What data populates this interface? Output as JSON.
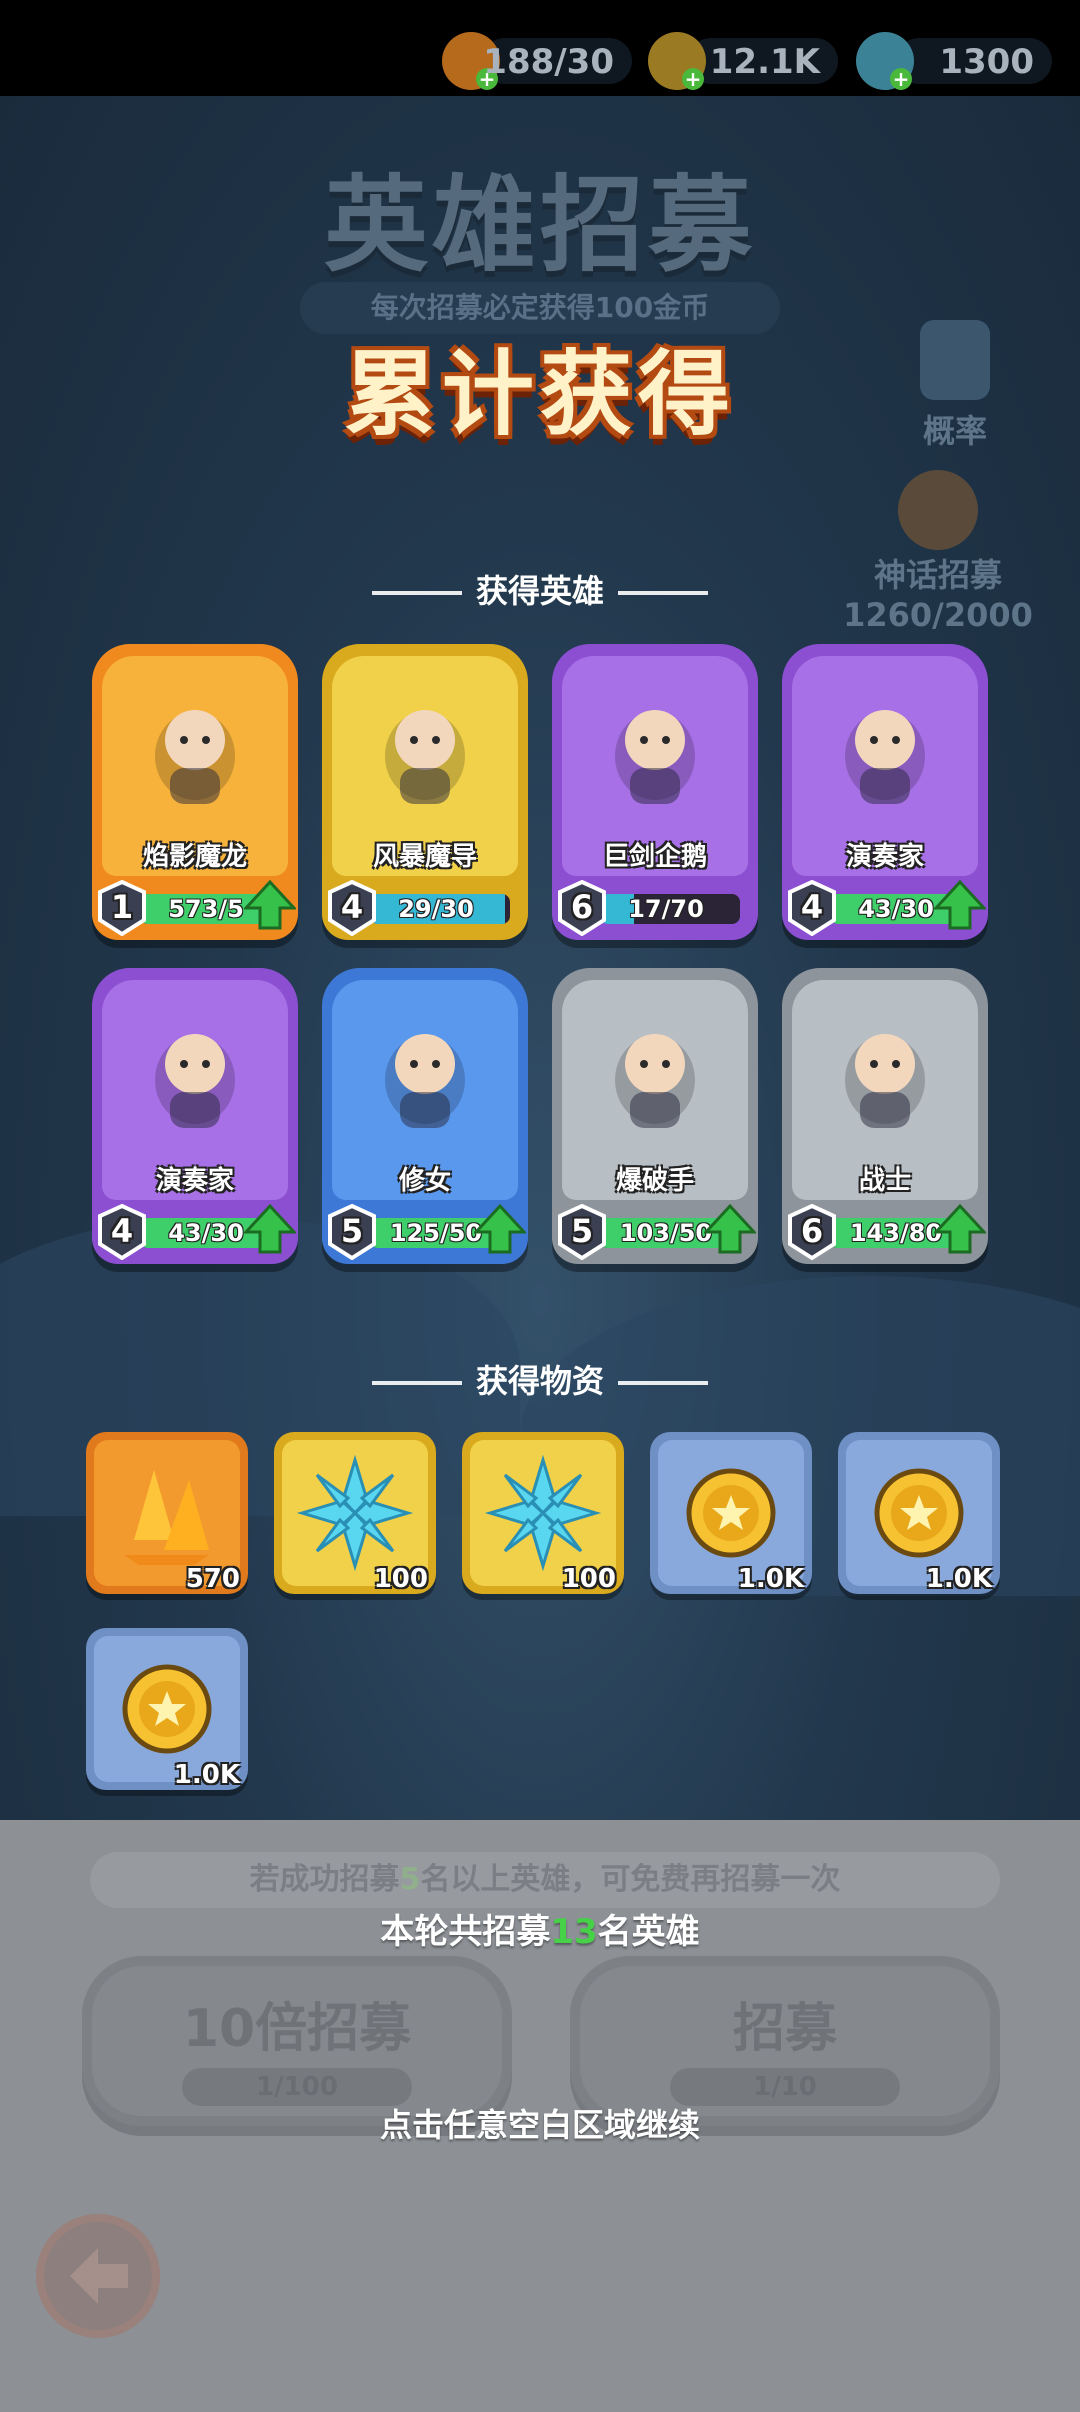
{
  "resources": [
    {
      "icon": "flame-stamina-icon",
      "value": "188/30",
      "color": "#e58a1f"
    },
    {
      "icon": "gold-coin-icon",
      "value": "12.1K",
      "color": "#e3b12a"
    },
    {
      "icon": "ice-crystal-icon",
      "value": "1300",
      "color": "#5fd0e6"
    }
  ],
  "background": {
    "title": "英雄招募",
    "subtitle": "每次招募必定获得100金币",
    "probability_label": "概率",
    "myth_label": "神话招募",
    "myth_progress": "1260/2000"
  },
  "popup": {
    "title": "累计获得",
    "heroes_section": "获得英雄",
    "items_section": "获得物资",
    "heroes": [
      {
        "name": "焰影魔龙",
        "level": "1",
        "progress": "573/5",
        "rarity": "orange",
        "can_upgrade": true
      },
      {
        "name": "风暴魔导",
        "level": "4",
        "progress": "29/30",
        "rarity": "gold",
        "can_upgrade": false
      },
      {
        "name": "巨剑企鹅",
        "level": "6",
        "progress": "17/70",
        "rarity": "purple",
        "can_upgrade": false
      },
      {
        "name": "演奏家",
        "level": "4",
        "progress": "43/30",
        "rarity": "purple",
        "can_upgrade": true
      },
      {
        "name": "演奏家",
        "level": "4",
        "progress": "43/30",
        "rarity": "purple",
        "can_upgrade": true
      },
      {
        "name": "修女",
        "level": "5",
        "progress": "125/50",
        "rarity": "blue",
        "can_upgrade": true
      },
      {
        "name": "爆破手",
        "level": "5",
        "progress": "103/50",
        "rarity": "gray",
        "can_upgrade": true
      },
      {
        "name": "战士",
        "level": "6",
        "progress": "143/80",
        "rarity": "gray",
        "can_upgrade": true
      }
    ],
    "items": [
      {
        "icon": "amber-crystal-icon",
        "qty": "570",
        "rarity": "orange"
      },
      {
        "icon": "ice-crystal-icon",
        "qty": "100",
        "rarity": "gold"
      },
      {
        "icon": "ice-crystal-icon",
        "qty": "100",
        "rarity": "gold"
      },
      {
        "icon": "gold-coin-icon",
        "qty": "1.0K",
        "rarity": "blue"
      },
      {
        "icon": "gold-coin-icon",
        "qty": "1.0K",
        "rarity": "blue"
      },
      {
        "icon": "gold-coin-icon",
        "qty": "1.0K",
        "rarity": "blue"
      }
    ]
  },
  "bottom": {
    "hint_pre": "若成功招募",
    "hint_num": "5",
    "hint_post": "名以上英雄，可免费再招募一次",
    "summary_pre": "本轮共招募",
    "summary_num": "13",
    "summary_post": "名英雄",
    "ten_recruit_label": "10倍招募",
    "ten_recruit_cost": "1/100",
    "recruit_label": "招募",
    "recruit_cost": "1/10",
    "continue": "点击任意空白区域继续"
  }
}
